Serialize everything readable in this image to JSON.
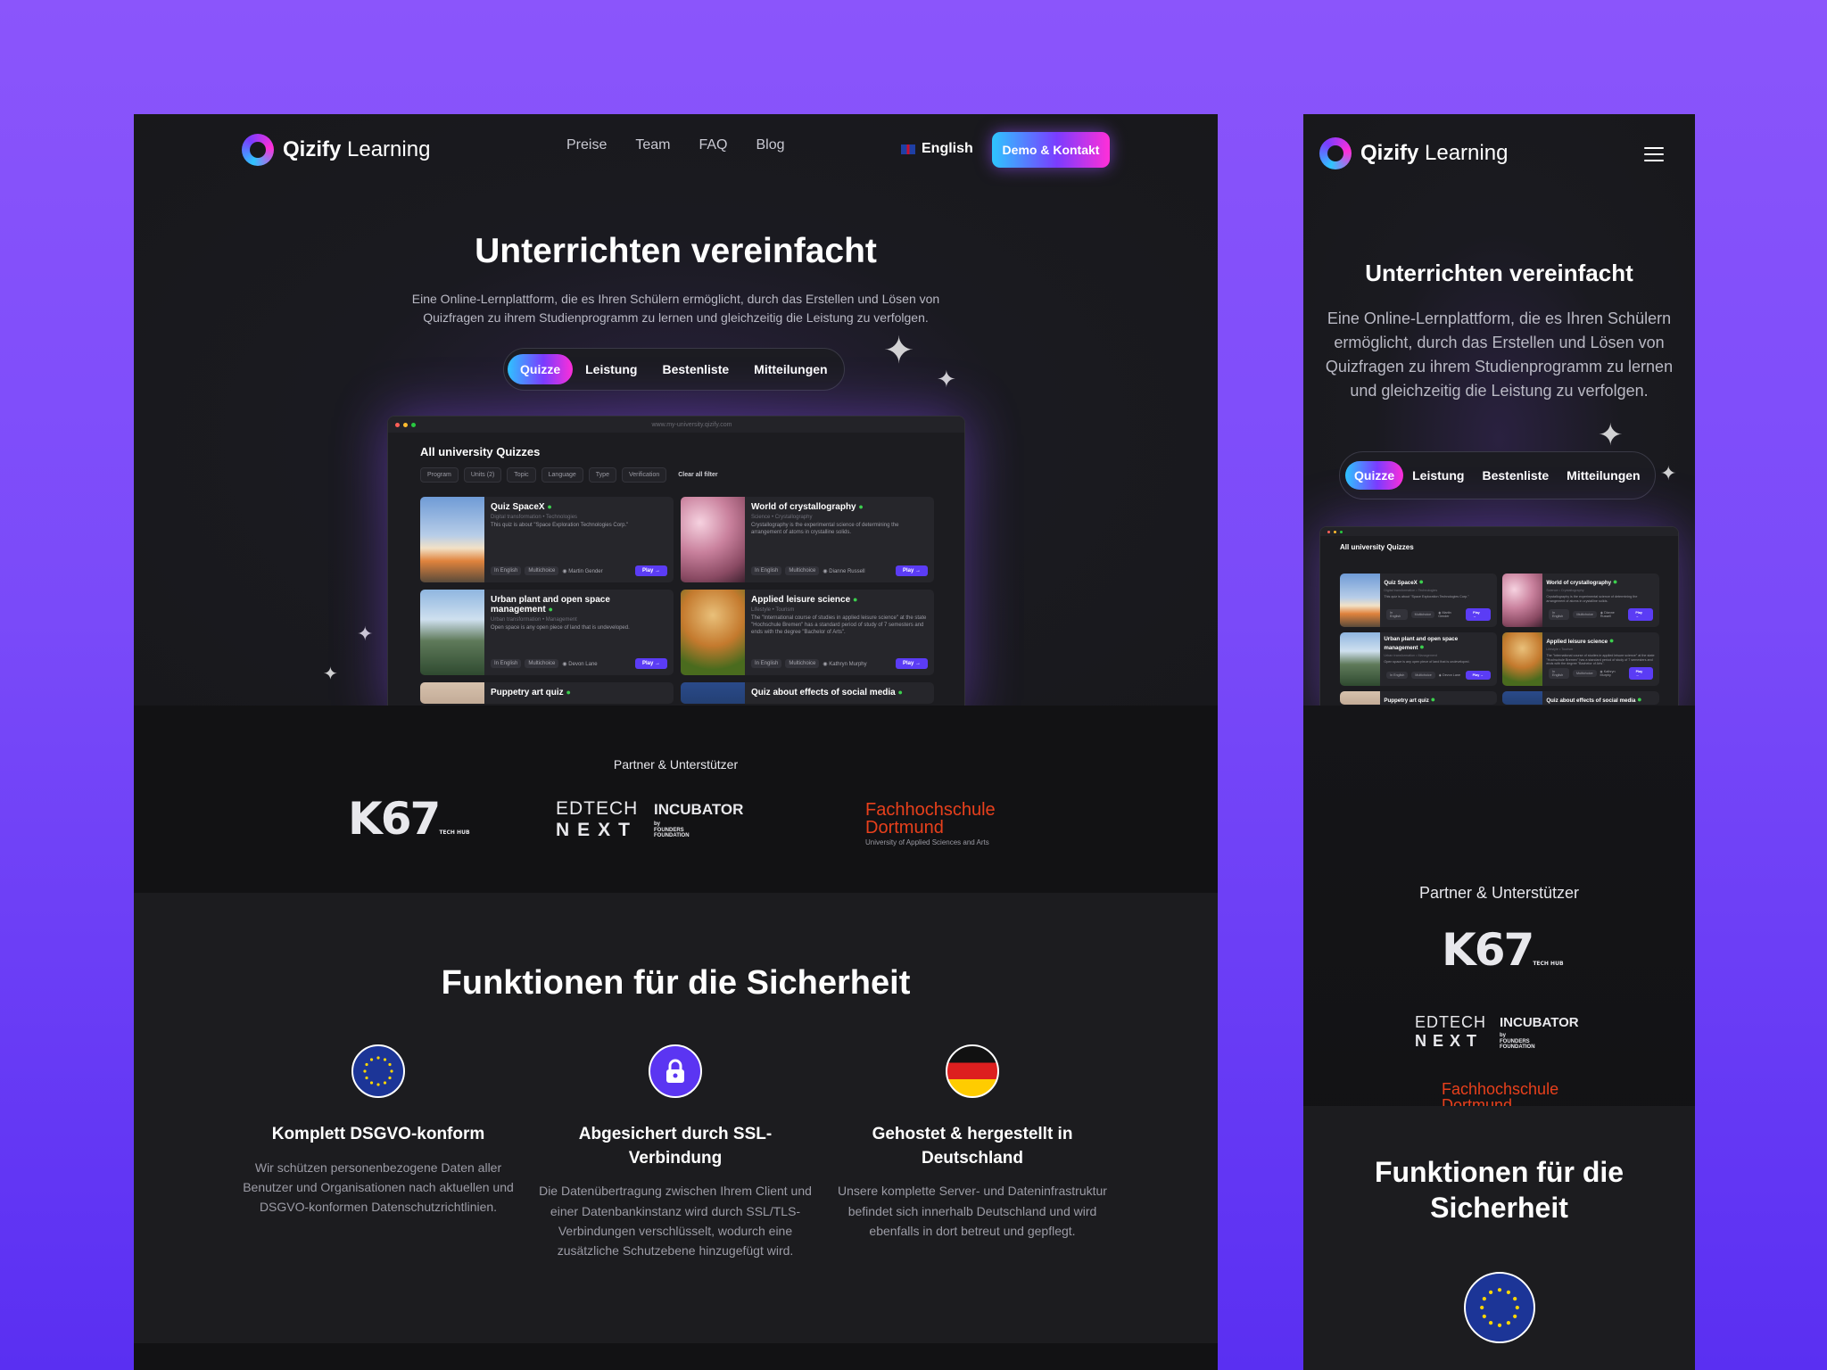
{
  "brand": {
    "name_bold": "Qizify",
    "name_light": "Learning"
  },
  "nav": {
    "links": [
      "Preise",
      "Team",
      "FAQ",
      "Blog"
    ],
    "language": "English",
    "cta": "Demo & Kontakt"
  },
  "hero": {
    "title": "Unterrichten vereinfacht",
    "subtitle": "Eine Online-Lernplattform, die es Ihren Schülern ermöglicht, durch das Erstellen und Lösen von Quizfragen zu ihrem Studienprogramm zu lernen und gleichzeitig die Leistung zu verfolgen.",
    "tabs": [
      "Quizze",
      "Leistung",
      "Bestenliste",
      "Mitteilungen"
    ]
  },
  "mockup": {
    "url": "www.my-university.qizify.com",
    "title": "All university Quizzes",
    "filters": [
      "Program",
      "Units (2)",
      "Topic",
      "Language",
      "Type",
      "Verification"
    ],
    "clear": "Clear all filter",
    "cards": [
      {
        "title": "Quiz SpaceX",
        "cat": "Digital transformation  •  Technologies",
        "desc": "This quiz is about \"Space Exploration Technologies Corp.\"",
        "tags": [
          "In English",
          "Multichoice"
        ],
        "author": "Martin Gender",
        "play": "Play →"
      },
      {
        "title": "World of crystallography",
        "cat": "Science  •  Crystallography",
        "desc": "Crystallography is the experimental science of determining the arrangement of atoms in crystalline solids.",
        "tags": [
          "In English",
          "Multichoice"
        ],
        "author": "Dianne Russell",
        "play": "Play →"
      },
      {
        "title": "Urban plant and open space management",
        "cat": "Urban transformation  •  Management",
        "desc": "Open space is any open piece of land that is undeveloped.",
        "tags": [
          "In English",
          "Multichoice"
        ],
        "author": "Devon Lane",
        "play": "Play →"
      },
      {
        "title": "Applied leisure science",
        "cat": "Lifestyle  •  Tourism",
        "desc": "The \"International course of studies in applied leisure science\" at the state \"Hochschule Bremen\" has a standard period of study of 7 semesters and ends with the degree \"Bachelor of Arts\".",
        "tags": [
          "In English",
          "Multichoice"
        ],
        "author": "Kathryn Murphy",
        "play": "Play →"
      },
      {
        "title": "Puppetry art quiz",
        "cat": "",
        "desc": "",
        "tags": [],
        "author": "",
        "play": ""
      },
      {
        "title": "Quiz about effects of social media",
        "cat": "",
        "desc": "",
        "tags": [],
        "author": "",
        "play": ""
      }
    ]
  },
  "partners": {
    "title": "Partner & Unterstützer",
    "k67": "K67",
    "k67_sub1": "TECH",
    "k67_sub2": "HUB",
    "edtech_1": "EDTECH",
    "edtech_2": "NEXT",
    "incubator": "INCUBATOR",
    "by": "by",
    "ff1": "FOUNDERS",
    "ff2": "FOUNDATION",
    "fh_1": "Fachhochschule",
    "fh_2": "Dortmund",
    "fh_sub": "University of Applied Sciences and Arts"
  },
  "security": {
    "title": "Funktionen für die Sicherheit",
    "features": [
      {
        "icon": "eu-flag-icon",
        "title": "Komplett DSGVO-konform",
        "text": "Wir schützen personenbezogene Daten aller Benutzer und Organisationen nach aktuellen und DSGVO-konformen Datenschutzrichtlinien."
      },
      {
        "icon": "lock-icon",
        "title": "Abgesichert durch SSL-Verbindung",
        "text": "Die Datenübertragung zwischen Ihrem Client und einer Datenbankinstanz wird durch SSL/TLS-Verbindungen verschlüsselt, wodurch eine zusätzliche Schutzebene hinzugefügt wird."
      },
      {
        "icon": "german-flag-icon",
        "title": "Gehostet & hergestellt in Deutschland",
        "text": "Unsere komplette Server- und Dateninfrastruktur befindet sich innerhalb Deutschland und wird ebenfalls in dort betreut und gepflegt."
      }
    ]
  },
  "mobile": {
    "title_1": "Funktionen für die",
    "title_2": "Sicherheit"
  },
  "colors": {
    "bg_purple": "#8b55fb",
    "accent_cyan": "#2ec5ff",
    "accent_pink": "#ff2fd8",
    "play_blue": "#5b3cf5",
    "fh_red": "#e8401c"
  }
}
